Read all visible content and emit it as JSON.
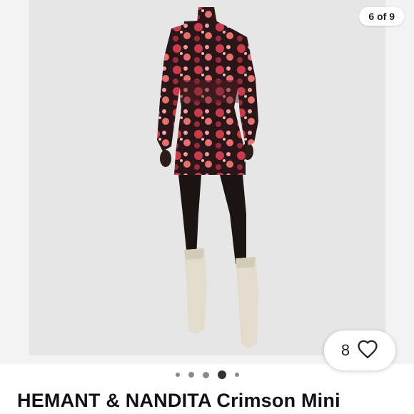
{
  "listing": {
    "image_counter": "6 of 9",
    "like_count": "8",
    "title": "HEMANT & NANDITA Crimson Mini"
  },
  "carousel": {
    "dot_count": 5,
    "active_index": 3
  },
  "icons": {
    "like": "heart-icon"
  },
  "colors": {
    "dress_base": "#2a1518",
    "dress_floral": "#c83c4c",
    "boots": "#e3dccd",
    "backdrop": "#e6e6e6"
  }
}
